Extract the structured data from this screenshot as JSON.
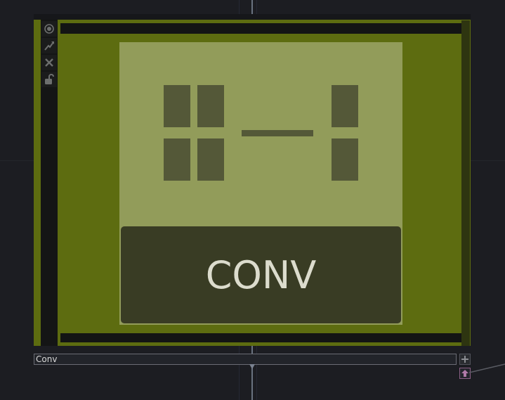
{
  "node": {
    "name_value": "Conv",
    "icon_label": "CONV",
    "toolbar": {
      "items": [
        {
          "icon": "viewer-toggle-icon"
        },
        {
          "icon": "bypass-icon"
        },
        {
          "icon": "delete-icon"
        },
        {
          "icon": "lock-icon"
        }
      ]
    }
  },
  "colors": {
    "node_body": "#5d6c10",
    "icon_background": "#929c5a",
    "label_box": "#393c24",
    "canvas": "#1c1d22"
  }
}
